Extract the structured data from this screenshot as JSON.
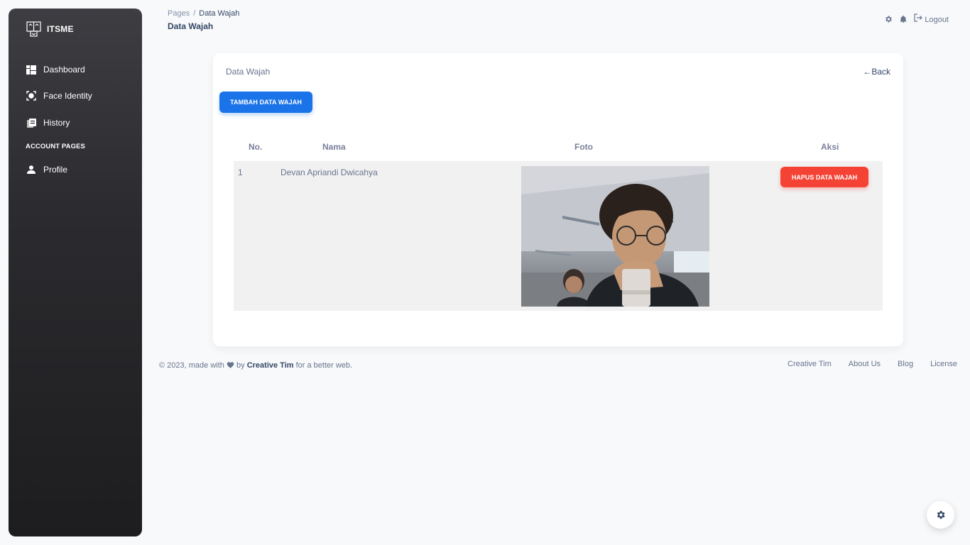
{
  "sidebar": {
    "brand": "ITSME",
    "items": [
      {
        "label": "Dashboard",
        "icon": "dashboard-icon"
      },
      {
        "label": "Face Identity",
        "icon": "face-scan-icon"
      },
      {
        "label": "History",
        "icon": "history-icon"
      }
    ],
    "section_label": "ACCOUNT PAGES",
    "account_items": [
      {
        "label": "Profile",
        "icon": "person-icon"
      }
    ]
  },
  "navbar": {
    "breadcrumb_root": "Pages",
    "breadcrumb_sep": "/",
    "breadcrumb_current": "Data Wajah",
    "title": "Data Wajah",
    "logout_label": "Logout"
  },
  "card": {
    "title": "Data Wajah",
    "back_label": "←Back",
    "add_button": "TAMBAH DATA WAJAH",
    "columns": [
      "No.",
      "Nama",
      "Foto",
      "Aksi"
    ],
    "rows": [
      {
        "no": "1",
        "nama": "Devan Apriandi Dwicahya",
        "action_label": "HAPUS DATA WAJAH"
      }
    ]
  },
  "footer": {
    "prefix": "© 2023, made with",
    "by": "by",
    "author": "Creative Tim",
    "suffix": "for a better web.",
    "links": [
      "Creative Tim",
      "About Us",
      "Blog",
      "License"
    ]
  },
  "colors": {
    "primary": "#1a73e8",
    "danger": "#f44335",
    "sidebar_dark": "#1d1d1f"
  }
}
